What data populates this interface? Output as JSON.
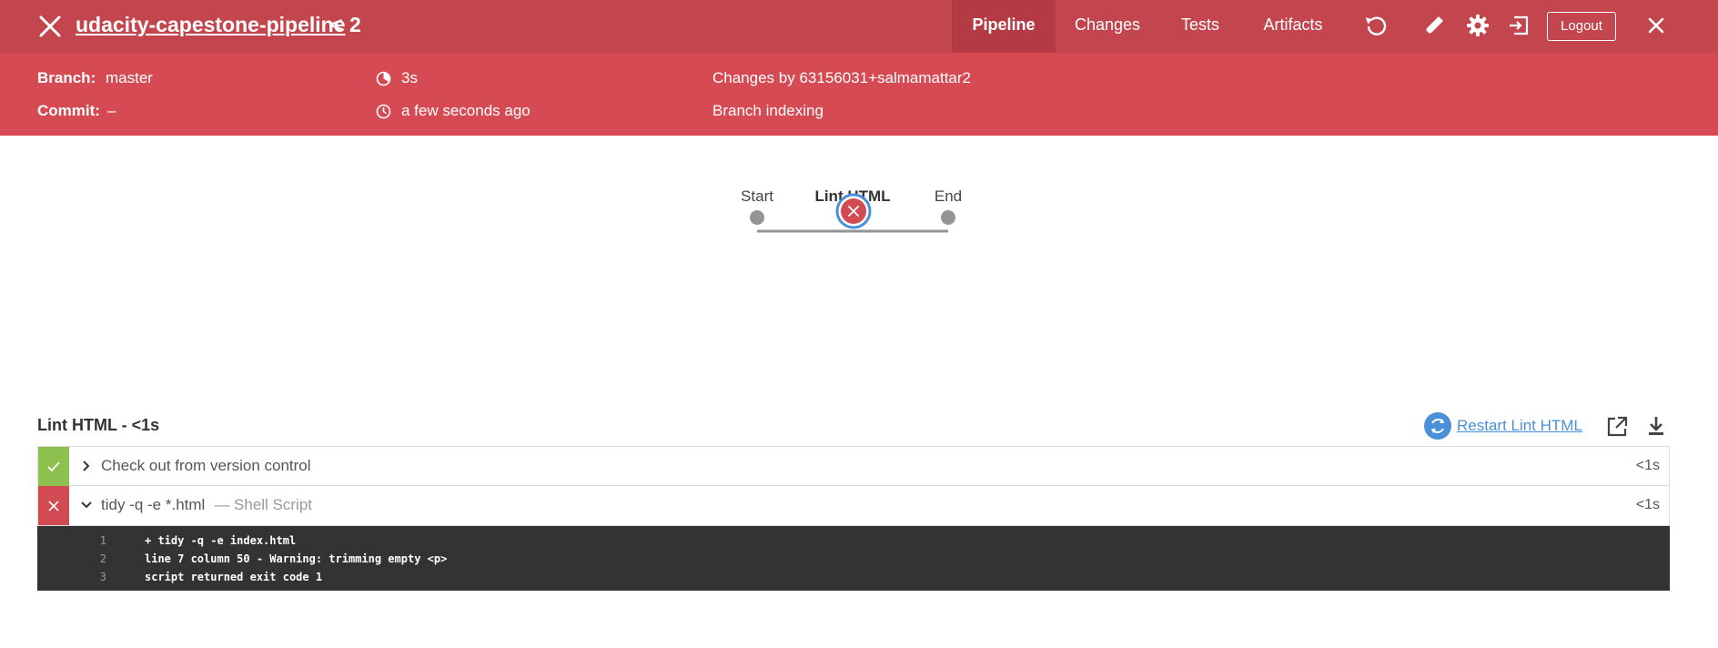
{
  "header": {
    "title": "udacity-capestone-pipeline",
    "run_separator": "<",
    "run_number": "2",
    "tabs": [
      "Pipeline",
      "Changes",
      "Tests",
      "Artifacts"
    ],
    "logout_label": "Logout",
    "accent_color": "#c3454d"
  },
  "info": {
    "branch_label": "Branch:",
    "branch_value": "master",
    "commit_label": "Commit:",
    "commit_value": "–",
    "duration": "3s",
    "started": "a few seconds ago",
    "changes_by": "Changes by 63156031+salmamattar2",
    "cause": "Branch indexing"
  },
  "pipeline": {
    "stages": [
      {
        "label": "Start",
        "status": "none"
      },
      {
        "label": "Lint HTML",
        "status": "failed",
        "selected": true
      },
      {
        "label": "End",
        "status": "none"
      }
    ]
  },
  "detail": {
    "title": "Lint HTML - <1s",
    "restart_label": "Restart Lint HTML",
    "steps": [
      {
        "status": "success",
        "text": "Check out from version control",
        "subtext": "",
        "duration": "<1s",
        "expanded": false
      },
      {
        "status": "failed",
        "text": "tidy -q -e *.html",
        "subtext": "— Shell Script",
        "duration": "<1s",
        "expanded": true
      }
    ],
    "log": [
      {
        "num": "1",
        "text": "+ tidy -q -e index.html"
      },
      {
        "num": "2",
        "text": "line 7 column 50 - Warning: trimming empty <p>"
      },
      {
        "num": "3",
        "text": "script returned exit code 1"
      }
    ]
  },
  "icons": [
    "close-icon",
    "replay-icon",
    "edit-icon",
    "gear-icon",
    "exit-icon",
    "chevron-right-icon",
    "chevron-down-icon",
    "check-icon",
    "x-icon",
    "restart-icon",
    "open-external-icon",
    "download-icon",
    "clock-icon",
    "duration-icon"
  ]
}
